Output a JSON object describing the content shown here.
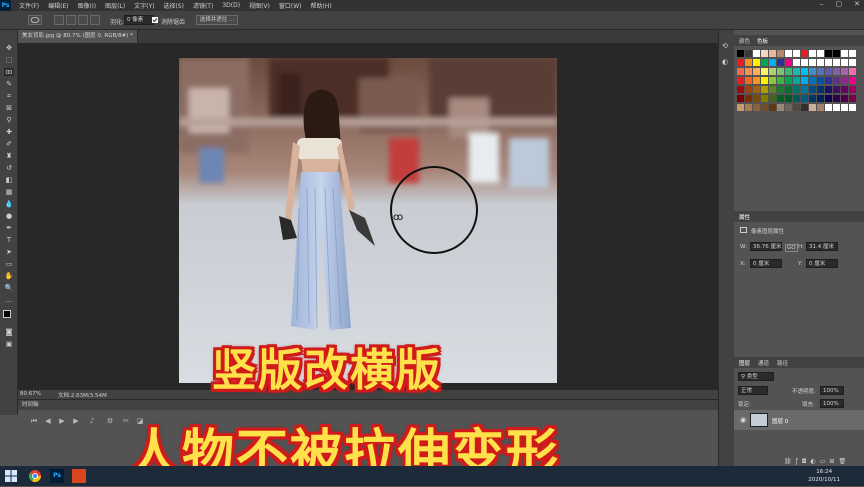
{
  "app": {
    "logo": "Ps",
    "menu": [
      "文件(F)",
      "编辑(E)",
      "图像(I)",
      "图层(L)",
      "文字(Y)",
      "选择(S)",
      "滤镜(T)",
      "3D(D)",
      "视图(V)",
      "窗口(W)",
      "帮助(H)"
    ],
    "window_controls": [
      "–",
      "▢",
      "✕"
    ]
  },
  "options_bar": {
    "feather_label": "羽化:",
    "feather_value": "0 像素",
    "antialias_label": "消除锯齿",
    "select_mask_button": "选择并遮住 ..."
  },
  "document": {
    "tab_title": "美女背影.jpg @ 80.7% (图层 0, RGB/8#) *",
    "zoom": "80.67%",
    "doc_size": "文档:2.63M/3.54M"
  },
  "timeline": {
    "title": "时间轴"
  },
  "panels": {
    "swatches_tabs": [
      "颜色",
      "色板"
    ],
    "properties_title": "属性",
    "properties_subtitle": "像素图层属性",
    "w_label": "W:",
    "w_value": "36.76 厘米",
    "go_label": "GO",
    "h_label": "H:",
    "h_value": "31.4 厘米",
    "x_label": "X:",
    "x_value": "0 厘米",
    "y_label": "Y:",
    "y_value": "0 厘米",
    "layers_tabs": [
      "图层",
      "通道",
      "路径"
    ],
    "kind_label": "类型",
    "blend_mode": "正常",
    "opacity_label": "不透明度:",
    "opacity_value": "100%",
    "lock_label": "锁定:",
    "fill_label": "填充:",
    "fill_value": "100%",
    "layer_name": "图层 0"
  },
  "overlay": {
    "line1": "竖版改横版",
    "line2": "人物不被拉伸变形"
  },
  "taskbar": {
    "time": "16:24",
    "date": "2020/10/11"
  },
  "colors": {
    "overlay_text": "#ffe14a",
    "overlay_outline": "#d11a1a",
    "ui_dark": "#323232",
    "ui_panel": "#424242",
    "ui_bg": "#535353",
    "ps_blue": "#31a8ff"
  }
}
